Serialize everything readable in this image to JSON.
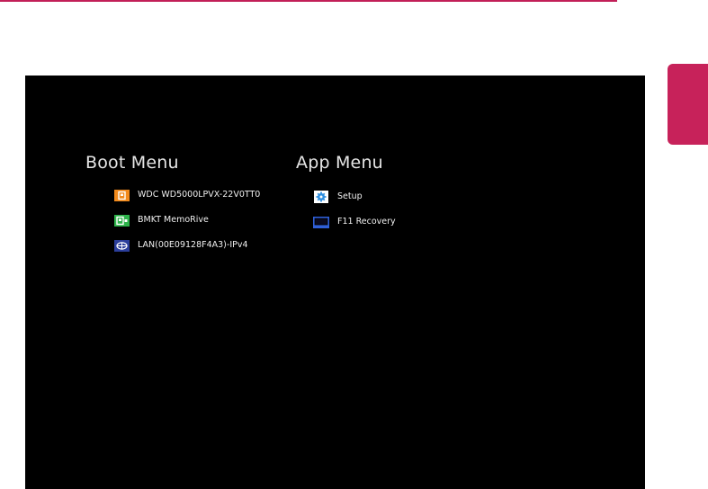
{
  "boot_menu": {
    "title": "Boot Menu",
    "items": [
      {
        "label": "WDC WD5000LPVX-22V0TT0",
        "icon": "hard-drive-icon",
        "icon_color": "#f28a1c"
      },
      {
        "label": "BMKT MemoRive",
        "icon": "usb-drive-icon",
        "icon_color": "#2db34a"
      },
      {
        "label": "LAN(00E09128F4A3)-IPv4",
        "icon": "network-icon",
        "icon_color": "#2b3e9b"
      }
    ]
  },
  "app_menu": {
    "title": "App Menu",
    "items": [
      {
        "label": "Setup",
        "icon": "gear-icon",
        "icon_color": "#2f8fe0"
      },
      {
        "label": "F11 Recovery",
        "icon": "monitor-icon",
        "icon_color": "#2f5fd8"
      }
    ]
  },
  "colors": {
    "accent": "#c7225a",
    "screen_background": "#000000",
    "text": "#f0f0f0"
  }
}
